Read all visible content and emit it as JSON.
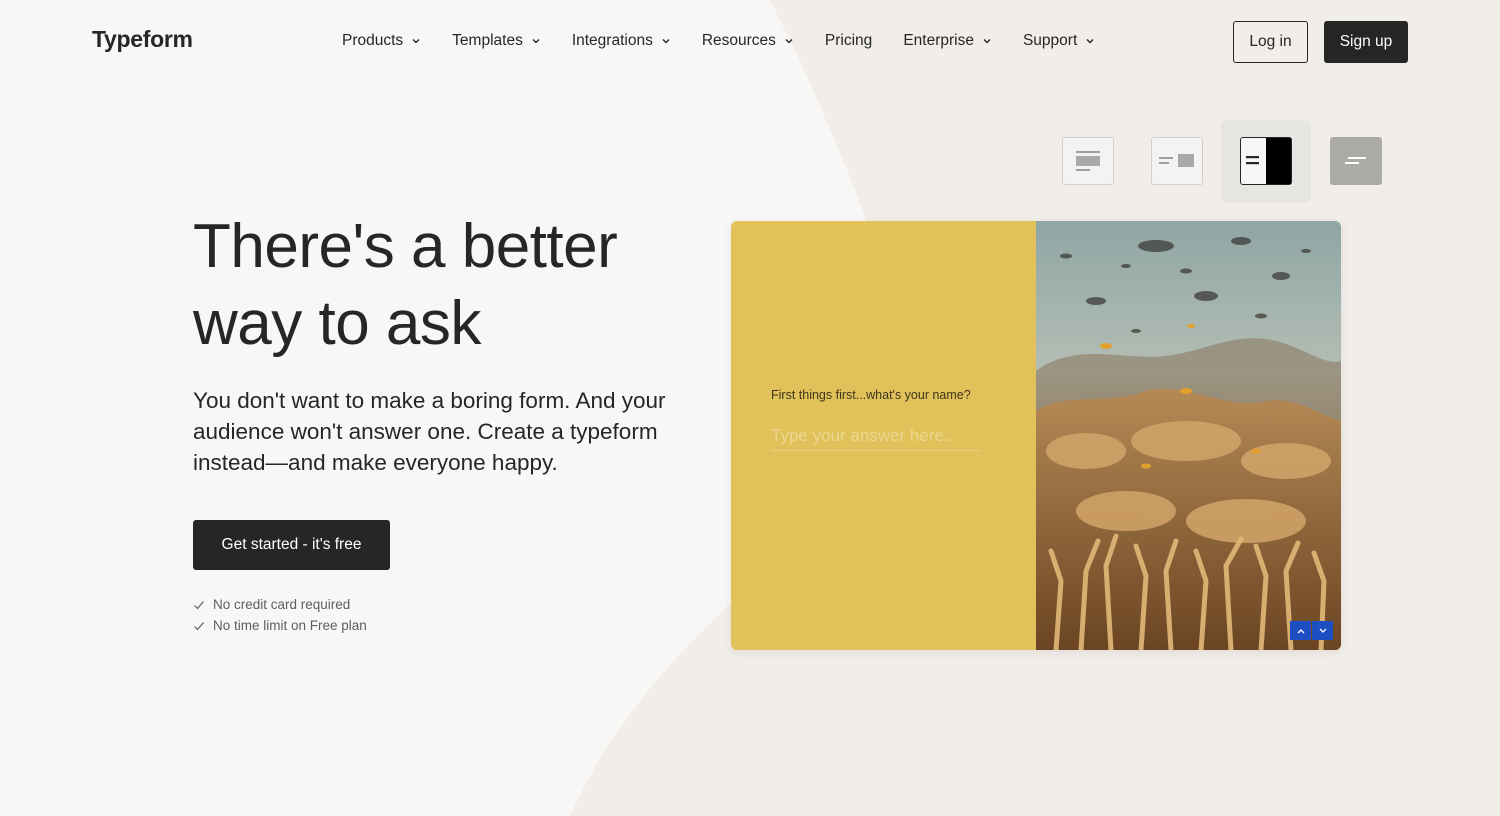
{
  "brand": {
    "logo": "Typeform"
  },
  "nav": {
    "items": [
      {
        "label": "Products",
        "dropdown": true
      },
      {
        "label": "Templates",
        "dropdown": true
      },
      {
        "label": "Integrations",
        "dropdown": true
      },
      {
        "label": "Resources",
        "dropdown": true
      },
      {
        "label": "Pricing",
        "dropdown": false
      },
      {
        "label": "Enterprise",
        "dropdown": true
      },
      {
        "label": "Support",
        "dropdown": true
      }
    ],
    "login_label": "Log in",
    "signup_label": "Sign up"
  },
  "layout_switcher": {
    "options": [
      "layout-stack-icon",
      "layout-split-icon",
      "layout-split-dark-icon",
      "layout-text-icon"
    ],
    "selected_index": 2
  },
  "hero": {
    "title_line1": "There's a better",
    "title_line2": "way to ask",
    "subtitle": "You don't want to make a boring form. And your audience won't answer one. Create a typeform instead—and make everyone happy.",
    "cta_label": "Get started - it's free",
    "checks": [
      "No credit card required",
      "No time limit on Free plan"
    ]
  },
  "preview": {
    "question": "First things first...what's your name?",
    "answer_placeholder": "Type your answer here...",
    "panel_color": "#e1c25a",
    "nav_color": "#1e4fc2"
  },
  "colors": {
    "background": "#f8f7f5",
    "ink": "#262627",
    "accent_shape": "#f1ede9"
  }
}
